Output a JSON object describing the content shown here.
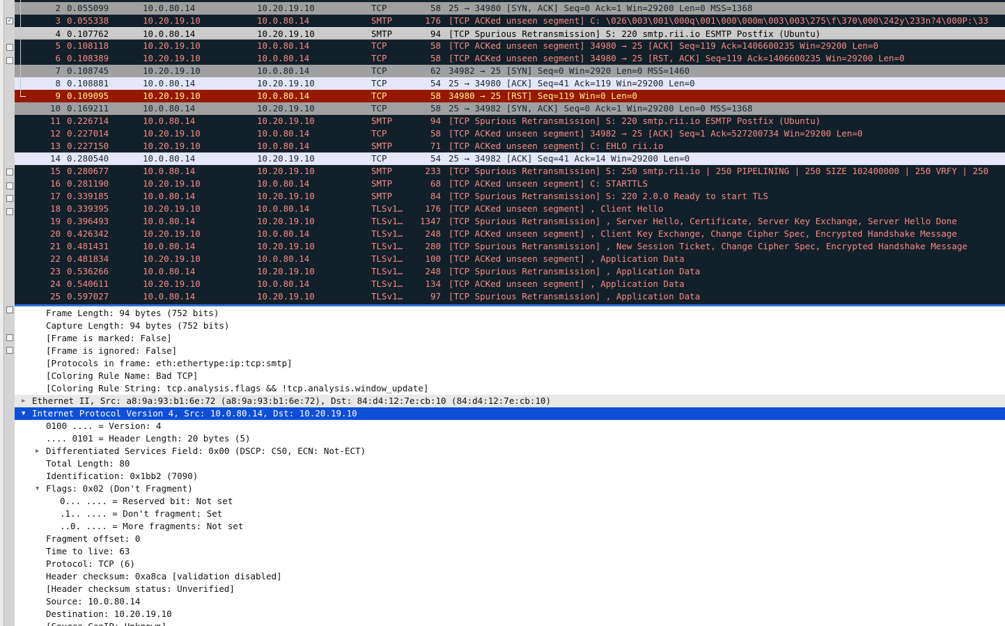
{
  "packet_list": {
    "rows": [
      {
        "no": "2",
        "time": "0.055099",
        "src": "10.0.80.14",
        "dst": "10.20.19.10",
        "proto": "TCP",
        "len": "58",
        "info": "25 → 34980 [SYN, ACK] Seq=0 Ack=1 Win=29200 Len=0 MSS=1368",
        "style": "gray"
      },
      {
        "no": "3",
        "time": "0.055338",
        "src": "10.20.19.10",
        "dst": "10.0.80.14",
        "proto": "SMTP",
        "len": "176",
        "info": "[TCP ACKed unseen segment] C: \\026\\003\\001\\000q\\001\\000\\000m\\003\\003\\275\\f\\370\\000\\242y\\233n?4\\000P:\\33",
        "style": "dark"
      },
      {
        "no": "4",
        "time": "0.107762",
        "src": "10.0.80.14",
        "dst": "10.20.19.10",
        "proto": "SMTP",
        "len": "94",
        "info": "[TCP Spurious Retransmission] S: 220 smtp.rii.io ESMTP Postfix (Ubuntu)",
        "style": "sel"
      },
      {
        "no": "5",
        "time": "0.108118",
        "src": "10.20.19.10",
        "dst": "10.0.80.14",
        "proto": "TCP",
        "len": "58",
        "info": "[TCP ACKed unseen segment] 34980 → 25 [ACK] Seq=119 Ack=1406600235 Win=29200 Len=0",
        "style": "dark"
      },
      {
        "no": "6",
        "time": "0.108389",
        "src": "10.20.19.10",
        "dst": "10.0.80.14",
        "proto": "TCP",
        "len": "58",
        "info": "[TCP ACKed unseen segment] 34980 → 25 [RST, ACK] Seq=119 Ack=1406600235 Win=29200 Len=0",
        "style": "dark"
      },
      {
        "no": "7",
        "time": "0.108745",
        "src": "10.20.19.10",
        "dst": "10.0.80.14",
        "proto": "TCP",
        "len": "62",
        "info": "34982 → 25 [SYN] Seq=0 Win=2920 Len=0 MSS=1460",
        "style": "gray"
      },
      {
        "no": "8",
        "time": "0.108881",
        "src": "10.0.80.14",
        "dst": "10.20.19.10",
        "proto": "TCP",
        "len": "54",
        "info": "25 → 34980 [ACK] Seq=41 Ack=119 Win=29200 Len=0",
        "style": "lav"
      },
      {
        "no": "9",
        "time": "0.109095",
        "src": "10.20.19.10",
        "dst": "10.0.80.14",
        "proto": "TCP",
        "len": "58",
        "info": "34980 → 25 [RST] Seq=119 Win=0 Len=0",
        "style": "red"
      },
      {
        "no": "10",
        "time": "0.169211",
        "src": "10.0.80.14",
        "dst": "10.20.19.10",
        "proto": "TCP",
        "len": "58",
        "info": "25 → 34982 [SYN, ACK] Seq=0 Ack=1 Win=29200 Len=0 MSS=1368",
        "style": "gray"
      },
      {
        "no": "11",
        "time": "0.226714",
        "src": "10.0.80.14",
        "dst": "10.20.19.10",
        "proto": "SMTP",
        "len": "94",
        "info": "[TCP Spurious Retransmission] S: 220 smtp.rii.io ESMTP Postfix (Ubuntu)",
        "style": "dark"
      },
      {
        "no": "12",
        "time": "0.227014",
        "src": "10.20.19.10",
        "dst": "10.0.80.14",
        "proto": "TCP",
        "len": "58",
        "info": "[TCP ACKed unseen segment] 34982 → 25 [ACK] Seq=1 Ack=527200734 Win=29200 Len=0",
        "style": "dark"
      },
      {
        "no": "13",
        "time": "0.227150",
        "src": "10.20.19.10",
        "dst": "10.0.80.14",
        "proto": "SMTP",
        "len": "71",
        "info": "[TCP ACKed unseen segment] C: EHLO rii.io",
        "style": "dark"
      },
      {
        "no": "14",
        "time": "0.280540",
        "src": "10.0.80.14",
        "dst": "10.20.19.10",
        "proto": "TCP",
        "len": "54",
        "info": "25 → 34982 [ACK] Seq=41 Ack=14 Win=29200 Len=0",
        "style": "lav"
      },
      {
        "no": "15",
        "time": "0.280677",
        "src": "10.0.80.14",
        "dst": "10.20.19.10",
        "proto": "SMTP",
        "len": "233",
        "info": "[TCP Spurious Retransmission] S: 250 smtp.rii.io | 250 PIPELINING | 250 SIZE 102400000 | 250 VRFY | 250",
        "style": "dark"
      },
      {
        "no": "16",
        "time": "0.281190",
        "src": "10.20.19.10",
        "dst": "10.0.80.14",
        "proto": "SMTP",
        "len": "68",
        "info": "[TCP ACKed unseen segment] C: STARTTLS",
        "style": "dark"
      },
      {
        "no": "17",
        "time": "0.339185",
        "src": "10.0.80.14",
        "dst": "10.20.19.10",
        "proto": "SMTP",
        "len": "84",
        "info": "[TCP Spurious Retransmission] S: 220 2.0.0 Ready to start TLS",
        "style": "dark"
      },
      {
        "no": "18",
        "time": "0.339395",
        "src": "10.20.19.10",
        "dst": "10.0.80.14",
        "proto": "TLSv1…",
        "len": "176",
        "info": "[TCP ACKed unseen segment] , Client Hello",
        "style": "dark"
      },
      {
        "no": "19",
        "time": "0.396493",
        "src": "10.0.80.14",
        "dst": "10.20.19.10",
        "proto": "TLSv1…",
        "len": "1347",
        "info": "[TCP Spurious Retransmission] , Server Hello, Certificate, Server Key Exchange, Server Hello Done",
        "style": "dark"
      },
      {
        "no": "20",
        "time": "0.426342",
        "src": "10.20.19.10",
        "dst": "10.0.80.14",
        "proto": "TLSv1…",
        "len": "248",
        "info": "[TCP ACKed unseen segment] , Client Key Exchange, Change Cipher Spec, Encrypted Handshake Message",
        "style": "dark"
      },
      {
        "no": "21",
        "time": "0.481431",
        "src": "10.0.80.14",
        "dst": "10.20.19.10",
        "proto": "TLSv1…",
        "len": "280",
        "info": "[TCP Spurious Retransmission] , New Session Ticket, Change Cipher Spec, Encrypted Handshake Message",
        "style": "dark"
      },
      {
        "no": "22",
        "time": "0.481834",
        "src": "10.20.19.10",
        "dst": "10.0.80.14",
        "proto": "TLSv1…",
        "len": "100",
        "info": "[TCP ACKed unseen segment] , Application Data",
        "style": "dark"
      },
      {
        "no": "23",
        "time": "0.536266",
        "src": "10.0.80.14",
        "dst": "10.20.19.10",
        "proto": "TLSv1…",
        "len": "248",
        "info": "[TCP Spurious Retransmission] , Application Data",
        "style": "dark"
      },
      {
        "no": "24",
        "time": "0.540611",
        "src": "10.20.19.10",
        "dst": "10.0.80.14",
        "proto": "TLSv1…",
        "len": "134",
        "info": "[TCP ACKed unseen segment] , Application Data",
        "style": "dark"
      },
      {
        "no": "25",
        "time": "0.597027",
        "src": "10.0.80.14",
        "dst": "10.20.19.10",
        "proto": "TLSv1…",
        "len": "97",
        "info": "[TCP Spurious Retransmission] , Application Data",
        "style": "dark"
      }
    ]
  },
  "details": {
    "rows": [
      {
        "text": "Frame Length: 94 bytes (752 bits)",
        "level": 1
      },
      {
        "text": "Capture Length: 94 bytes (752 bits)",
        "level": 1
      },
      {
        "text": "[Frame is marked: False]",
        "level": 1
      },
      {
        "text": "[Frame is ignored: False]",
        "level": 1
      },
      {
        "text": "[Protocols in frame: eth:ethertype:ip:tcp:smtp]",
        "level": 1
      },
      {
        "text": "[Coloring Rule Name: Bad TCP]",
        "level": 1
      },
      {
        "text": "[Coloring Rule String: tcp.analysis.flags && !tcp.analysis.window_update]",
        "level": 1
      },
      {
        "text": "Ethernet II, Src: a8:9a:93:b1:6e:72 (a8:9a:93:b1:6e:72), Dst: 84:d4:12:7e:cb:10 (84:d4:12:7e:cb:10)",
        "level": 0,
        "arrow": "collapsed",
        "style": "head"
      },
      {
        "text": "Internet Protocol Version 4, Src: 10.0.80.14, Dst: 10.20.19.10",
        "level": 0,
        "arrow": "expanded",
        "style": "sel"
      },
      {
        "text": "0100 .... = Version: 4",
        "level": 1
      },
      {
        "text": ".... 0101 = Header Length: 20 bytes (5)",
        "level": 1
      },
      {
        "text": "Differentiated Services Field: 0x00 (DSCP: CS0, ECN: Not-ECT)",
        "level": 1,
        "arrow": "collapsed"
      },
      {
        "text": "Total Length: 80",
        "level": 1
      },
      {
        "text": "Identification: 0x1bb2 (7090)",
        "level": 1
      },
      {
        "text": "Flags: 0x02 (Don't Fragment)",
        "level": 1,
        "arrow": "expanded"
      },
      {
        "text": "0... .... = Reserved bit: Not set",
        "level": 2
      },
      {
        "text": ".1.. .... = Don't fragment: Set",
        "level": 2
      },
      {
        "text": "..0. .... = More fragments: Not set",
        "level": 2
      },
      {
        "text": "Fragment offset: 0",
        "level": 1
      },
      {
        "text": "Time to live: 63",
        "level": 1
      },
      {
        "text": "Protocol: TCP (6)",
        "level": 1
      },
      {
        "text": "Header checksum: 0xa8ca [validation disabled]",
        "level": 1
      },
      {
        "text": "[Header checksum status: Unverified]",
        "level": 1
      },
      {
        "text": "Source: 10.0.80.14",
        "level": 1
      },
      {
        "text": "Destination: 10.20.19.10",
        "level": 1
      },
      {
        "text": "[Source GeoIP: Unknown]",
        "level": 1
      }
    ]
  },
  "colors": {
    "bad_tcp_bg": "#12202a",
    "bad_tcp_fg": "#f78a84",
    "rst_bg": "#961800",
    "rst_fg": "#fff38a",
    "selection": "#0d4fd6"
  }
}
